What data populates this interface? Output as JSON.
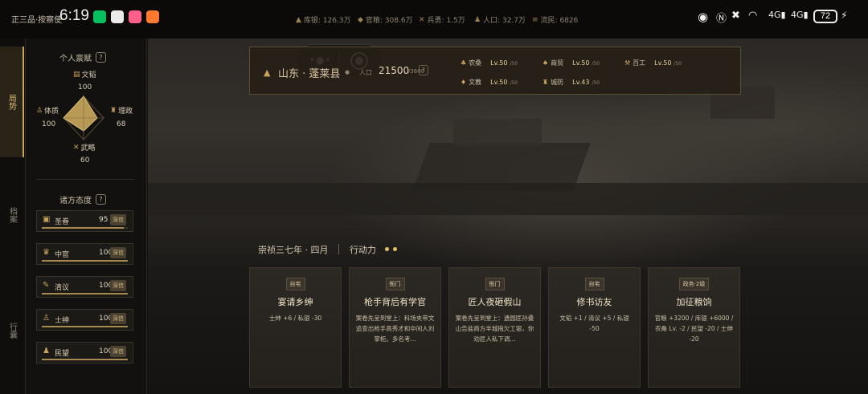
{
  "statusbar": {
    "rank": "正三品·按察使",
    "time": "6:19",
    "resources": [
      {
        "icon": "treasury-icon",
        "label": "库银: 126.3万"
      },
      {
        "icon": "coin-icon",
        "label": "官粮: 308.6万"
      },
      {
        "icon": "soldier-icon",
        "label": "兵勇: 1.5万"
      },
      {
        "icon": "people-icon",
        "label": "人口: 32.7万"
      },
      {
        "icon": "refugee-icon",
        "label": "流民: 6826"
      }
    ],
    "battery": "72"
  },
  "nav": {
    "items": [
      {
        "label": "局势",
        "active": true
      },
      {
        "label": "档案",
        "active": false
      },
      {
        "label": "行囊",
        "active": false
      }
    ]
  },
  "personal": {
    "title": "个人禀赋",
    "help": "?",
    "attributes": {
      "wen": {
        "label": "文韬",
        "value": "100"
      },
      "zheng": {
        "label": "理政",
        "value": "68"
      },
      "wu": {
        "label": "武略",
        "value": "60"
      },
      "ti": {
        "label": "体质",
        "value": "100"
      }
    }
  },
  "factions": {
    "title": "诸方态度",
    "help": "?",
    "items": [
      {
        "icon": "emperor-icon",
        "name": "圣眷",
        "value": "95",
        "badge": "深信",
        "level": 0.95
      },
      {
        "icon": "official-icon",
        "name": "中官",
        "value": "100",
        "badge": "深信",
        "level": 1.0
      },
      {
        "icon": "scholar-icon",
        "name": "清议",
        "value": "100",
        "badge": "深信",
        "level": 1.0
      },
      {
        "icon": "gentry-icon",
        "name": "士绅",
        "value": "100",
        "badge": "深信",
        "level": 1.0
      },
      {
        "icon": "populace-icon",
        "name": "民望",
        "value": "100",
        "badge": "深信",
        "level": 1.0
      }
    ]
  },
  "location": {
    "name": "山东 · 蓬莱县",
    "pop_label": "人口",
    "pop_value": "21500",
    "pop_max": "/3600",
    "help": "?",
    "stats": [
      {
        "icon": "farm-icon",
        "label": "农桑",
        "level": "Lv.50",
        "max": "/50"
      },
      {
        "icon": "trade-icon",
        "label": "商贸",
        "level": "Lv.50",
        "max": "/50"
      },
      {
        "icon": "craft-icon",
        "label": "百工",
        "level": "Lv.50",
        "max": "/50"
      },
      {
        "icon": "education-icon",
        "label": "文教",
        "level": "Lv.50",
        "max": "/50"
      },
      {
        "icon": "defense-icon",
        "label": "城防",
        "level": "Lv.43",
        "max": "/50"
      }
    ]
  },
  "turn": {
    "date": "崇祯三七年 · 四月",
    "ap_label": "行动力",
    "ap_count": 2
  },
  "cards": [
    {
      "tag": "自宅",
      "title": "宴请乡绅",
      "desc": "士绅 +6 / 私银 -30"
    },
    {
      "tag": "衙门",
      "title": "枪手背后有学官",
      "desc": "案卷先呈到堂上：科场夹带文追查出枪手高秀才和中间人刘掌柜。多名考..."
    },
    {
      "tag": "衙门",
      "title": "匠人夜砸假山",
      "desc": "案卷先呈到堂上：遗园匠孙叠山告盐商方半城拖欠工银，你劝匠人私下调..."
    },
    {
      "tag": "自宅",
      "title": "修书访友",
      "desc": "文韬 +1 / 清议 +5 / 私银 -50"
    },
    {
      "tag": "政务·2级",
      "title": "加征粮饷",
      "desc": "官粮 +3200 / 库银 +6000 / 农桑 Lv. -2 / 民望 -20 / 士绅 -20"
    }
  ]
}
